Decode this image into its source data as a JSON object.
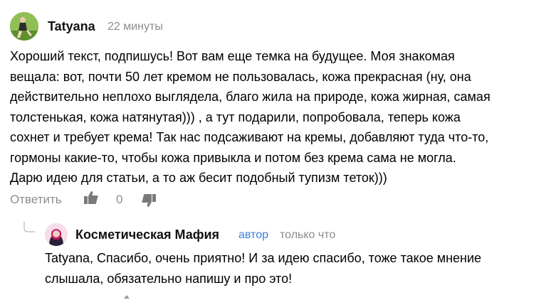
{
  "comment": {
    "author": "Tatyana",
    "time": "22 минуты",
    "text": "Хороший текст, подпишусь! Вот вам еще темка на будущее. Моя знакомая\nвещала: вот, почти 50 лет кремом не пользовалась, кожа прекрасная (ну, она\nдействительно неплохо выглядела, благо жила на природе, кожа жирная, самая\nтолстенькая, кожа натянутая))) , а тут подарили, попробовала, теперь кожа\nсохнет и требует крема! Так нас подсаживают на кремы, добавляют туда что-то,\nгормоны какие-то, чтобы кожа привыкла и потом без крема сама не могла.\nДарю идею для статьи, а то аж бесит подобный тупизм теток)))",
    "actions": {
      "reply_label": "Ответить",
      "like_icon": "thumbs-up-icon",
      "rating": "0",
      "dislike_icon": "thumbs-down-icon"
    }
  },
  "reply": {
    "author": "Косметическая Мафия",
    "badge": "автор",
    "time": "только что",
    "text": "Tatyana, Спасибо, очень приятно! И за идею спасибо, тоже такое мнение\nслышала, обязательно напишу и про это!"
  },
  "colors": {
    "muted": "#8c8c8c",
    "author_badge": "#3d7fd6",
    "icon": "#7a7a7a"
  }
}
